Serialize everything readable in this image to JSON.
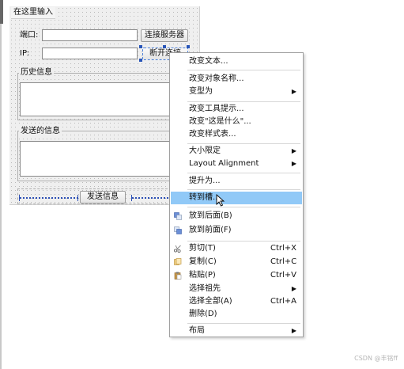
{
  "form": {
    "title": "在这里输入",
    "port_label": "端口:",
    "ip_label": "IP:",
    "connect_button": "连接服务器",
    "disconnect_button": "断开连接",
    "history_title": "历史信息",
    "send_title": "发送的信息",
    "send_button": "发送信息"
  },
  "context_menu": {
    "items": [
      {
        "label": "改变文本...",
        "shortcut": "",
        "submenu": false,
        "icon": ""
      },
      {
        "label": "改变对象名称...",
        "shortcut": "",
        "submenu": false,
        "icon": ""
      },
      {
        "label": "变型为",
        "shortcut": "",
        "submenu": true,
        "icon": ""
      },
      {
        "label": "改变工具提示...",
        "shortcut": "",
        "submenu": false,
        "icon": ""
      },
      {
        "label": "改变\"这是什么\"...",
        "shortcut": "",
        "submenu": false,
        "icon": ""
      },
      {
        "label": "改变样式表...",
        "shortcut": "",
        "submenu": false,
        "icon": ""
      },
      {
        "label": "大小限定",
        "shortcut": "",
        "submenu": true,
        "icon": ""
      },
      {
        "label": "Layout Alignment",
        "shortcut": "",
        "submenu": true,
        "icon": ""
      },
      {
        "label": "提升为...",
        "shortcut": "",
        "submenu": false,
        "icon": ""
      },
      {
        "label": "转到槽...",
        "shortcut": "",
        "submenu": false,
        "icon": "",
        "highlighted": true
      },
      {
        "label": "放到后面(B)",
        "shortcut": "",
        "submenu": false,
        "icon": "send-to-back-icon"
      },
      {
        "label": "放到前面(F)",
        "shortcut": "",
        "submenu": false,
        "icon": "bring-to-front-icon"
      },
      {
        "label": "剪切(T)",
        "shortcut": "Ctrl+X",
        "submenu": false,
        "icon": "scissors-icon"
      },
      {
        "label": "复制(C)",
        "shortcut": "Ctrl+C",
        "submenu": false,
        "icon": "copy-icon"
      },
      {
        "label": "粘贴(P)",
        "shortcut": "Ctrl+V",
        "submenu": false,
        "icon": "paste-icon"
      },
      {
        "label": "选择祖先",
        "shortcut": "",
        "submenu": true,
        "icon": ""
      },
      {
        "label": "选择全部(A)",
        "shortcut": "Ctrl+A",
        "submenu": false,
        "icon": ""
      },
      {
        "label": "删除(D)",
        "shortcut": "",
        "submenu": false,
        "icon": ""
      },
      {
        "label": "布局",
        "shortcut": "",
        "submenu": true,
        "icon": ""
      }
    ]
  },
  "watermark": "CSDN @丰铭ff",
  "colors": {
    "highlight": "#91c9f7",
    "selection_handle": "#2855b8",
    "spacer": "#2b4fb5"
  }
}
